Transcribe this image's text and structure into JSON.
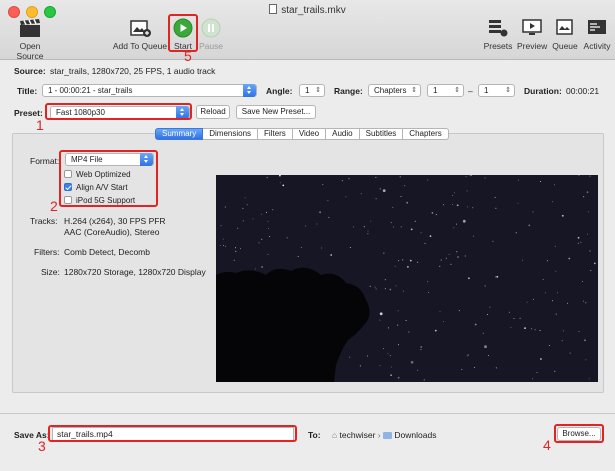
{
  "window": {
    "title": "star_trails.mkv"
  },
  "toolbar": {
    "open_source": "Open Source",
    "add_to_queue": "Add To Queue",
    "start": "Start",
    "pause": "Pause",
    "presets": "Presets",
    "preview": "Preview",
    "queue": "Queue",
    "activity": "Activity"
  },
  "source": {
    "label": "Source:",
    "value": "star_trails, 1280x720, 25 FPS, 1 audio track"
  },
  "title_row": {
    "label": "Title:",
    "value": "1 - 00:00:21 - star_trails",
    "angle_label": "Angle:",
    "angle": "1",
    "range_label": "Range:",
    "range_type": "Chapters",
    "range_from": "1",
    "range_dash": "–",
    "range_to": "1",
    "duration_label": "Duration:",
    "duration": "00:00:21"
  },
  "preset": {
    "label": "Preset:",
    "value": "Fast 1080p30",
    "reload": "Reload",
    "save_new": "Save New Preset..."
  },
  "tabs": [
    "Summary",
    "Dimensions",
    "Filters",
    "Video",
    "Audio",
    "Subtitles",
    "Chapters"
  ],
  "summary": {
    "format_label": "Format:",
    "format": "MP4 File",
    "web_optimized": "Web Optimized",
    "align_av": "Align A/V Start",
    "ipod": "iPod 5G Support",
    "tracks_label": "Tracks:",
    "tracks_line1": "H.264 (x264), 30 FPS PFR",
    "tracks_line2": "AAC (CoreAudio), Stereo",
    "filters_label": "Filters:",
    "filters": "Comb Detect, Decomb",
    "size_label": "Size:",
    "size": "1280x720 Storage, 1280x720 Display"
  },
  "save": {
    "label": "Save As:",
    "filename": "star_trails.mp4",
    "to_label": "To:",
    "path_home": "techwiser",
    "path_sep": "›",
    "path_folder": "Downloads",
    "browse": "Browse..."
  },
  "annotations": {
    "n1": "1",
    "n2": "2",
    "n3": "3",
    "n4": "4",
    "n5": "5"
  },
  "colors": {
    "accent": "#3b82f0",
    "annotation": "#e02424",
    "start_green": "#3aa83a"
  }
}
